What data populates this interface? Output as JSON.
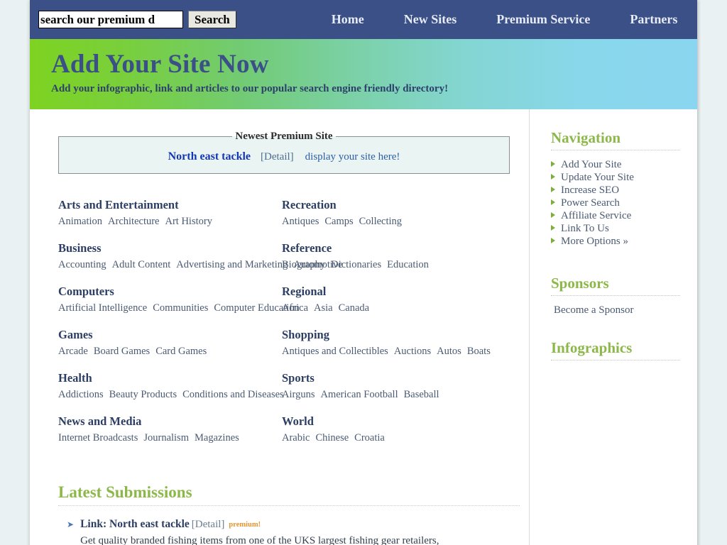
{
  "topbar": {
    "search": {
      "value": "search our premium d",
      "placeholder": "search our premium directory",
      "button_label": "Search"
    },
    "nav": [
      {
        "label": "Home"
      },
      {
        "label": "New Sites"
      },
      {
        "label": "Premium Service"
      },
      {
        "label": "Partners"
      }
    ]
  },
  "banner": {
    "title": "Add Your Site Now",
    "subtitle": "Add your infographic, link and articles to our popular search engine friendly directory!"
  },
  "premium": {
    "legend": "Newest Premium Site",
    "site_name": "North east tackle",
    "detail_label": "[Detail]",
    "cta_label": "display your site here!"
  },
  "categories": {
    "column1": [
      {
        "title": "Arts and Entertainment",
        "subs": [
          "Animation",
          "Architecture",
          "Art History"
        ]
      },
      {
        "title": "Business",
        "subs": [
          "Accounting",
          "Adult Content",
          "Advertising and Marketing",
          "Automotive"
        ]
      },
      {
        "title": "Computers",
        "subs": [
          "Artificial Intelligence",
          "Communities",
          "Computer Education"
        ]
      },
      {
        "title": "Games",
        "subs": [
          "Arcade",
          "Board Games",
          "Card Games"
        ]
      },
      {
        "title": "Health",
        "subs": [
          "Addictions",
          "Beauty Products",
          "Conditions and Diseases"
        ]
      },
      {
        "title": "News and Media",
        "subs": [
          "Internet Broadcasts",
          "Journalism",
          "Magazines"
        ]
      }
    ],
    "column2": [
      {
        "title": "Recreation",
        "subs": [
          "Antiques",
          "Camps",
          "Collecting"
        ]
      },
      {
        "title": "Reference",
        "subs": [
          "Biography",
          "Dictionaries",
          "Education"
        ]
      },
      {
        "title": "Regional",
        "subs": [
          "Africa",
          "Asia",
          "Canada"
        ]
      },
      {
        "title": "Shopping",
        "subs": [
          "Antiques and Collectibles",
          "Auctions",
          "Autos",
          "Boats"
        ]
      },
      {
        "title": "Sports",
        "subs": [
          "Airguns",
          "American Football",
          "Baseball"
        ]
      },
      {
        "title": "World",
        "subs": [
          "Arabic",
          "Chinese",
          "Croatia"
        ]
      }
    ]
  },
  "latest": {
    "heading": "Latest Submissions",
    "items": [
      {
        "prefix": "Link: ",
        "title": "North east tackle",
        "detail_label": "[Detail]",
        "badge": "premium!",
        "description": "Get quality branded fishing items from one of the UKS largest fishing gear retailers,"
      }
    ]
  },
  "sidebar": {
    "navigation": {
      "heading": "Navigation",
      "items": [
        {
          "label": "Add Your Site"
        },
        {
          "label": "Update Your Site"
        },
        {
          "label": "Increase SEO"
        },
        {
          "label": "Power Search"
        },
        {
          "label": "Affiliate Service"
        },
        {
          "label": "Link To Us"
        },
        {
          "label": "More Options »"
        }
      ]
    },
    "sponsors": {
      "heading": "Sponsors",
      "link_label": "Become a Sponsor"
    },
    "infographics": {
      "heading": "Infographics"
    }
  },
  "colors": {
    "topbar_bg": "#3b5087",
    "banner_gradient_start": "#7ed321",
    "banner_gradient_end": "#8ad6f0",
    "heading_green": "#8cb849",
    "heading_navy": "#2c3e63",
    "link_blue": "#1437b4",
    "badge_orange": "#e8942e",
    "page_bg": "#e9f1f2"
  }
}
